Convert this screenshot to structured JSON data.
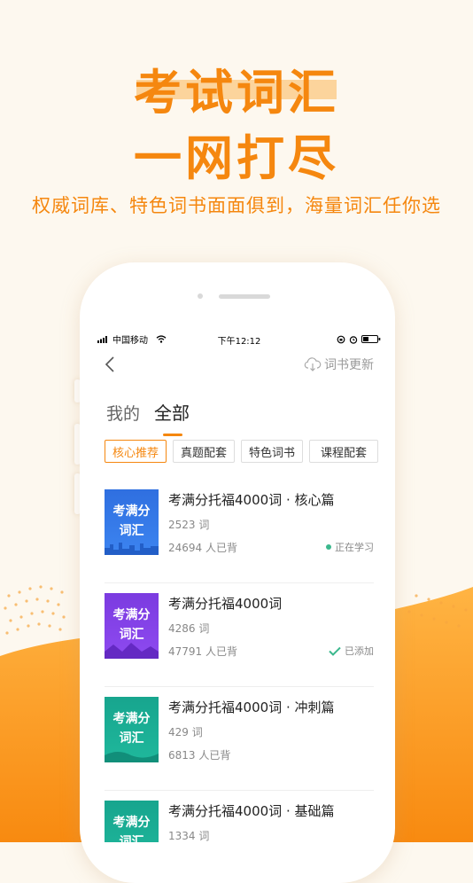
{
  "headline": {
    "line1": "考试词汇",
    "line2": "一网打尽"
  },
  "subtitle": "权威词库、特色词书面面俱到，海量词汇任你选",
  "colors": {
    "accent": "#f5870f",
    "green": "#3bb88d"
  },
  "statusbar": {
    "carrier": "中国移动",
    "time": "下午12:12"
  },
  "navbar": {
    "update_label": "词书更新"
  },
  "tabs": [
    {
      "label": "我的"
    },
    {
      "label": "全部"
    }
  ],
  "filters": [
    {
      "label": "核心推荐",
      "active": true
    },
    {
      "label": "真题配套"
    },
    {
      "label": "特色词书"
    },
    {
      "label": "课程配套"
    }
  ],
  "books": [
    {
      "cover_line1": "考满分",
      "cover_line2": "词汇",
      "title": "考满分托福4000词 · 核心篇",
      "count": "2523 词",
      "learners": "24694 人已背",
      "status": "正在学习",
      "status_icon": "green-dot-icon"
    },
    {
      "cover_line1": "考满分",
      "cover_line2": "词汇",
      "title": "考满分托福4000词",
      "count": "4286 词",
      "learners": "47791 人已背",
      "status": "已添加",
      "status_icon": "check-icon"
    },
    {
      "cover_line1": "考满分",
      "cover_line2": "词汇",
      "title": "考满分托福4000词 · 冲刺篇",
      "count": "429 词",
      "learners": "6813 人已背",
      "status": ""
    },
    {
      "cover_line1": "考满分",
      "cover_line2": "词汇",
      "title": "考满分托福4000词 · 基础篇",
      "count": "1334 词",
      "learners": "",
      "status": ""
    }
  ]
}
